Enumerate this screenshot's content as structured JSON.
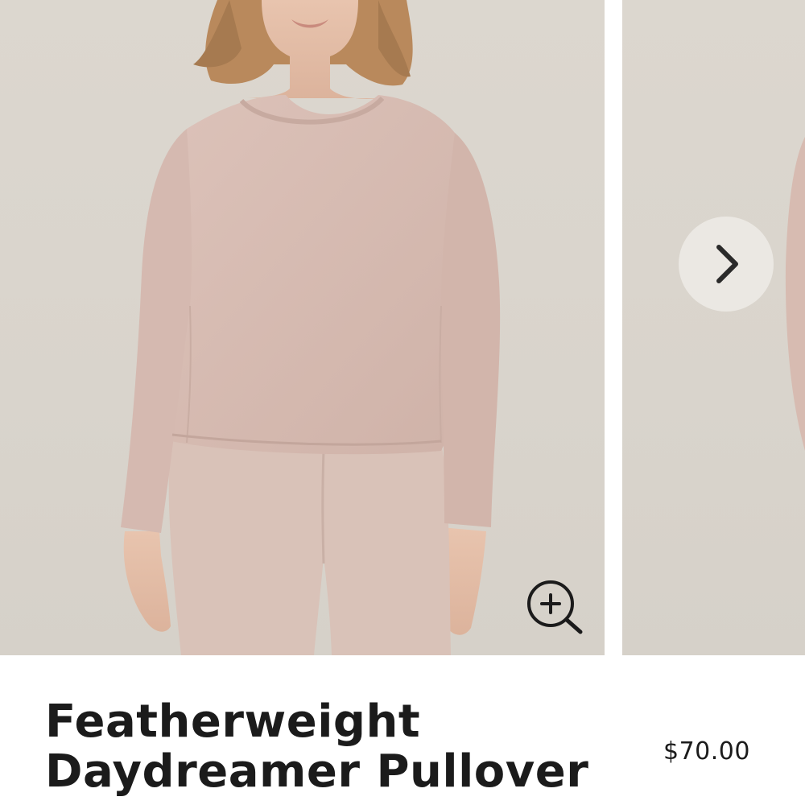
{
  "product": {
    "title_line1": "Featherweight",
    "title_line2": "Daydreamer Pullover",
    "price": "$70.00"
  },
  "gallery": {
    "zoom_icon": "zoom-in-icon",
    "next_icon": "chevron-right-icon"
  },
  "colors": {
    "backdrop": "#dcd7cf",
    "garment": "#d8bdb4",
    "text": "#1b1b1b",
    "nav_button": "#ebe8e3"
  }
}
